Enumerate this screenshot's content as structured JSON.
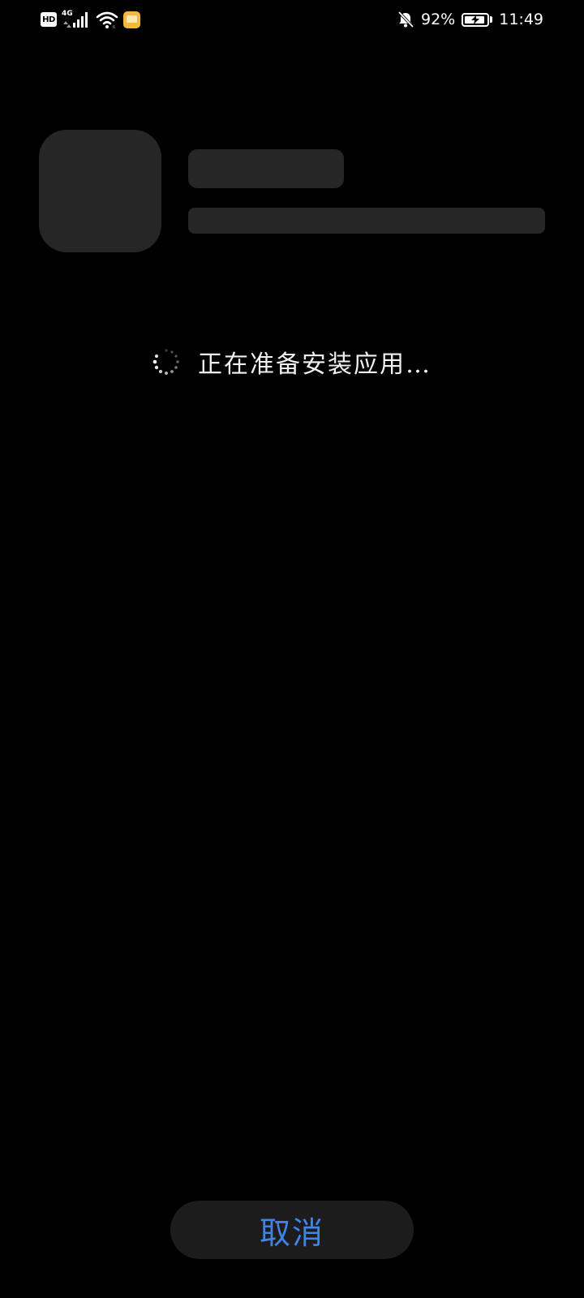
{
  "status_bar": {
    "hd_badge": "HD",
    "network_type": "4G",
    "battery_percent": "92%",
    "battery_level": 0.92,
    "time": "11:49",
    "icons": [
      "hd-icon",
      "cellular-signal-icon",
      "wifi-icon",
      "app-notification-icon",
      "mute-bell-icon",
      "battery-charging-icon"
    ]
  },
  "installer": {
    "progress_message": "正在准备安装应用…",
    "cancel_label": "取消"
  },
  "colors": {
    "background": "#000000",
    "placeholder": "#262626",
    "button_background": "#1c1c1c",
    "accent": "#3f84e6",
    "notify_icon": "#f2b941"
  }
}
